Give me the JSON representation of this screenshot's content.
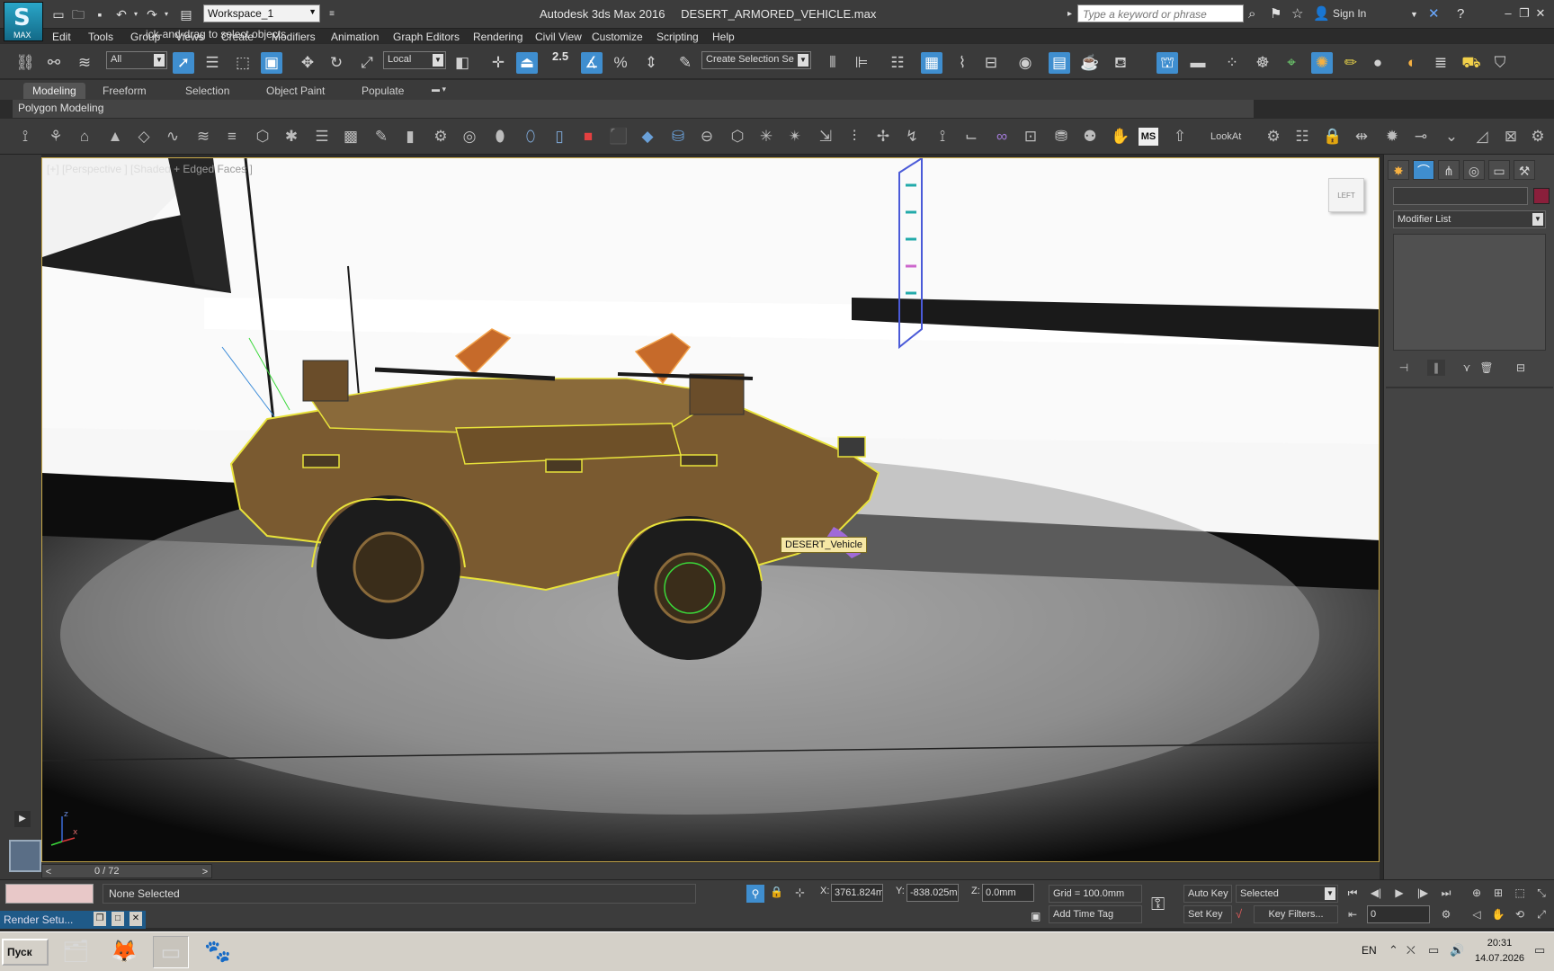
{
  "window": {
    "app_name": "Autodesk 3ds Max 2016",
    "file_name": "DESERT_ARMORED_VEHICLE.max",
    "logo_text": "MAX",
    "workspace": "Workspace_1",
    "search_placeholder": "Type a keyword or phrase",
    "sign_in": "Sign In"
  },
  "menu": [
    "Edit",
    "Tools",
    "Group",
    "Views",
    "Create",
    "Modifiers",
    "Animation",
    "Graph Editors",
    "Rendering",
    "Civil View",
    "Customize",
    "Scripting",
    "Help"
  ],
  "main_toolbar": {
    "selection_filter": "All",
    "reference_coord": "Local",
    "snap_label": "2.5",
    "named_selection": "Create Selection Se"
  },
  "ribbon": {
    "tabs": [
      "Modeling",
      "Freeform",
      "Selection",
      "Object Paint",
      "Populate"
    ],
    "active_tab": "Modeling",
    "sub_label": "Polygon Modeling",
    "lookat_label": "LookAt"
  },
  "viewport": {
    "label_main": "[+] [Perspective ] [Shaded",
    "label_dim": " + Edged Faces ]",
    "object_tooltip": "DESERT_Vehicle",
    "viewcube_label": "LEFT"
  },
  "timeline": {
    "frame_readout": "0 / 72",
    "prev": "<",
    "next": ">"
  },
  "status": {
    "selection": "None Selected",
    "prompt": "ick-and-drag to select objects",
    "render_setup_tab": "Render Setu...",
    "x_label": "X:",
    "x_value": "3761.824m",
    "y_label": "Y:",
    "y_value": "-838.025m",
    "z_label": "Z:",
    "z_value": "0.0mm",
    "grid": "Grid = 100.0mm",
    "add_time_tag": "Add Time Tag",
    "auto_key": "Auto Key",
    "set_key": "Set Key",
    "key_mode": "Selected",
    "key_filters": "Key Filters...",
    "current_frame": "0"
  },
  "command_panel": {
    "modifier_list": "Modifier List",
    "object_color": "#8a1f3b"
  },
  "taskbar": {
    "start_label": "Пуск",
    "language": "EN",
    "time": "20:31",
    "date": "14.07.2026"
  },
  "colors": {
    "accent": "#3f8ecf",
    "selection_outline": "#e8e23a",
    "vehicle_body": "#7a5a30",
    "tooltip_bg": "#f6e7a5"
  }
}
